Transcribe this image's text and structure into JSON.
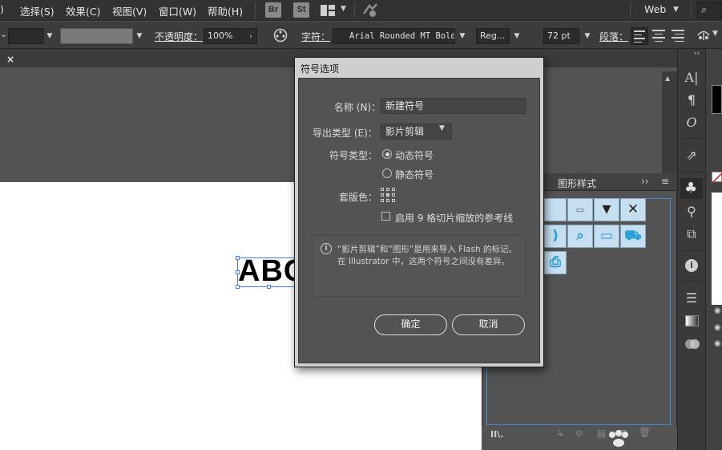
{
  "menubar": {
    "items": [
      ")",
      "选择(S)",
      "效果(C)",
      "视图(V)",
      "窗口(W)",
      "帮助(H)"
    ],
    "bridge_label": "Br",
    "stock_label": "St",
    "workspace": "Web"
  },
  "controlbar": {
    "opacity_label": "不透明度：",
    "opacity_value": "100%",
    "character_label": "字符：",
    "font_family": "Arial Rounded MT Bold",
    "font_style": "Reg...",
    "font_size": "72 pt",
    "paragraph_label": "段落："
  },
  "document": {
    "tab_close": "×",
    "text_content": "ABC"
  },
  "graphic_styles_panel": {
    "title": "图形样式",
    "expand_glyph": "››"
  },
  "dialog": {
    "title": "符号选项",
    "name_label": "名称 (N)：",
    "name_value": "新建符号",
    "export_type_label": "导出类型 (E)：",
    "export_type_value": "影片剪辑",
    "symbol_type_label": "符号类型：",
    "symbol_type_options": [
      "动态符号",
      "静态符号"
    ],
    "symbol_type_selected": "动态符号",
    "registration_label": "套版色：",
    "nine_slice_label": "启用 9 格切片缩放的参考线",
    "info_text": "“影片剪辑”和“图形”是用来导入 Flash 的标记。在 Illustrator 中，这两个符号之间没有差异。",
    "ok_label": "确定",
    "cancel_label": "取消"
  }
}
